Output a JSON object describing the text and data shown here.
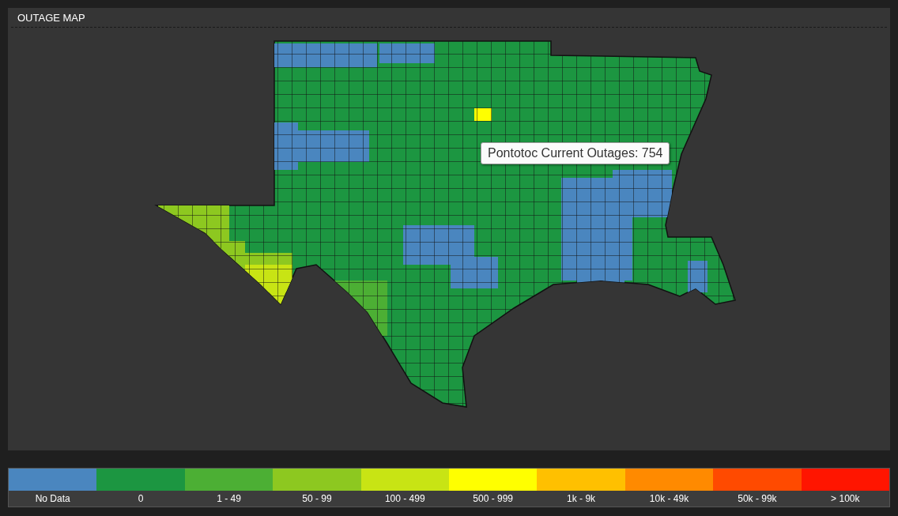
{
  "panel": {
    "title": "OUTAGE MAP"
  },
  "tooltip": {
    "text": "Pontotoc Current Outages: 754"
  },
  "legend": [
    {
      "label": "No Data",
      "color": "#4a86bf"
    },
    {
      "label": "0",
      "color": "#1c9641"
    },
    {
      "label": "1 - 49",
      "color": "#4caf34"
    },
    {
      "label": "50 - 99",
      "color": "#8dc820"
    },
    {
      "label": "100 - 499",
      "color": "#c8e414"
    },
    {
      "label": "500 - 999",
      "color": "#ffff00"
    },
    {
      "label": "1k - 9k",
      "color": "#ffc000"
    },
    {
      "label": "10k - 49k",
      "color": "#ff8a00"
    },
    {
      "label": "50k - 99k",
      "color": "#ff4a00"
    },
    {
      "label": "> 100k",
      "color": "#ff1500"
    }
  ]
}
